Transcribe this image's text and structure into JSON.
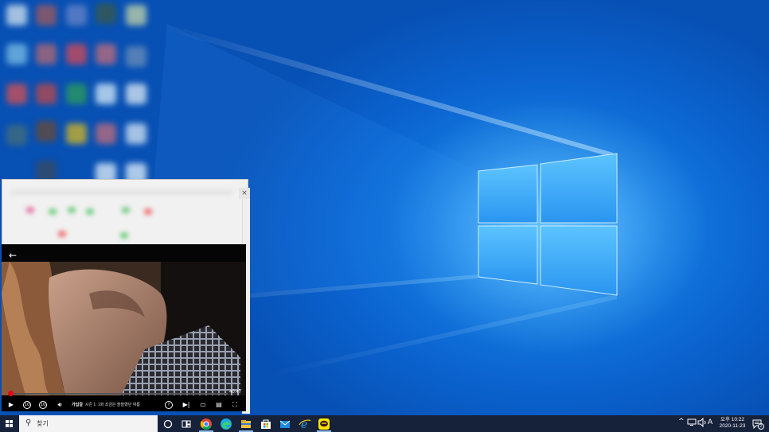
{
  "colors": {
    "accent_red": "#e50914",
    "taskbar_bg": "#16213a",
    "wallpaper_blue": "#0b63cf"
  },
  "desktop": {
    "wallpaper": "windows-10-logo-light-beams"
  },
  "player": {
    "back_icon": "arrow-left-icon",
    "time_remaining": "40:47",
    "progress_fraction": 0.01,
    "controls": {
      "play_icon": "play-icon",
      "rewind_label": "10",
      "forward_label": "10",
      "volume_icon": "volume-icon",
      "help_icon": "help-icon",
      "next_icon": "next-episode-icon",
      "episodes_icon": "episodes-icon",
      "subtitles_icon": "subtitles-icon",
      "fullscreen_icon": "fullscreen-icon"
    },
    "episode": {
      "title": "가십걸",
      "subtitle": "시즌 1: 1화 조금은 쓸쓸했던 여름"
    }
  },
  "taskbar": {
    "search_placeholder": "찾기",
    "icons": [
      "cortana-icon",
      "task-view-icon",
      "chrome-icon",
      "edge-icon",
      "file-explorer-icon",
      "store-icon",
      "mail-icon",
      "internet-explorer-icon",
      "kakaotalk-icon"
    ],
    "tray": {
      "chevron": "^",
      "ime_label": "A",
      "clock_time": "오후 10:22",
      "clock_date": "2020-11-23",
      "notification_count": "2"
    }
  }
}
